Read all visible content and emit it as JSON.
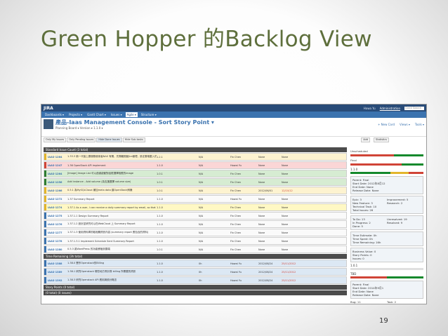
{
  "slide": {
    "title": "Green Hopper 的Backlog View",
    "page_number": "19"
  },
  "jira": {
    "logo": "JIRA",
    "user": "Howa Yu",
    "admin_link": "Administration",
    "search_placeholder": "Quick Search",
    "nav": [
      "Dashboards ▾",
      "Projects ▾",
      "Gantt Chart ▾",
      "Issues ▾",
      "Agile ▾",
      "Structure ▾"
    ],
    "nav_active_index": 4,
    "header": {
      "title": "產品-Iaas Management Console - Sort Story Point ▾",
      "subtitle": "Planning Board ▾   Version ▾   1.1.0 ▾",
      "actions": [
        "+ New Card",
        "Views ▾",
        "Tools ▾"
      ]
    },
    "filters": [
      "Only My Issues",
      "Only Pending Issues",
      "Hide Done Issues",
      "Hide Sub-tasks"
    ],
    "filters_selected_index": 2,
    "filter_right": [
      "Add",
      "Statistics"
    ],
    "sections": {
      "standard": "Standard Issue Count (3 total)",
      "time": "Time Remaining (3h total)",
      "story": "Story Points (0 total)",
      "extra": "(0 total) (0 issues)"
    },
    "rows_standard": [
      {
        "key": "IAAS-1264",
        "summary": "1.33.3 新一代接上雲服務使用者NAS 有關，先隔離推動Jira管理，設定雲端載入的轉換",
        "version": "1.2.1",
        "estimate": "N/A",
        "assignee": "Fin Chen",
        "reporter": "None",
        "due": "None",
        "color": "beige",
        "strip": "#e3b52c"
      },
      {
        "key": "IAAS-1247",
        "summary": "1.36 OpenStack API implement",
        "version": "1.1.0",
        "estimate": "N/A",
        "assignee": "Howai Yu",
        "reporter": "None",
        "due": "None",
        "color": "pink",
        "strip": "#d04437"
      },
      {
        "key": "IAAS-1264",
        "summary": "[Image] Image List 可以過濾啟動對話框選擇相應的image",
        "version": "1.0.1",
        "estimate": "N/A",
        "assignee": "Fin Chen",
        "reporter": "None",
        "due": "None",
        "color": "green",
        "strip": "#2e7d32"
      },
      {
        "key": "IAAS-1256",
        "summary": "Add instance - Add volume (為支援選擇 volume size)",
        "version": "1.0.1",
        "estimate": "N/A",
        "assignee": "Fin Chen",
        "reporter": "None",
        "due": "None",
        "color": "green",
        "strip": "#2e7d32"
      },
      {
        "key": "IAAS-1266",
        "summary": "0.5.1 為MySQLCloud 補加meta data 讓OpenStack辨識",
        "version": "1.0.1",
        "estimate": "N/A",
        "assignee": "Fin Chen",
        "reporter": "2012/06/01",
        "due": "12/10/12",
        "color": "beige",
        "strip": "#e3b52c"
      },
      {
        "key": "IAAS-1272",
        "summary": "1.37 Summary Report",
        "version": "1.1.0",
        "estimate": "N/A",
        "assignee": "Howai Yu",
        "reporter": "None",
        "due": "None",
        "color": "white",
        "strip": "#e3b52c"
      },
      {
        "key": "IAAS-1274",
        "summary": "1.37.1 As a user, I can receive a daily summary report by email, so that I can know my system status and health",
        "version": "1.1.0",
        "estimate": "N/A",
        "assignee": "Fin Chen",
        "reporter": "None",
        "due": "None",
        "color": "yellow",
        "strip": "#e3b52c"
      },
      {
        "key": "IAAS-1275",
        "summary": "1.37.1.1 Design Summary Report",
        "version": "1.1.0",
        "estimate": "N/A",
        "assignee": "Fin Chen",
        "reporter": "None",
        "due": "None",
        "color": "white",
        "strip": "#3b73af"
      },
      {
        "key": "IAAS-1276",
        "summary": "1.37.1.2 設計並研究可以在WebCloud 上 Summary Report",
        "version": "1.1.0",
        "estimate": "N/A",
        "assignee": "Fin Chen",
        "reporter": "None",
        "due": "None",
        "color": "white",
        "strip": "#3b73af"
      },
      {
        "key": "IAAS-1277",
        "summary": "1.37.1.3 使用資料庫抓取相關資訊內容 (summary report 應包含的資料)",
        "version": "1.1.0",
        "estimate": "N/A",
        "assignee": "Fin Chen",
        "reporter": "None",
        "due": "None",
        "color": "white",
        "strip": "#3b73af"
      },
      {
        "key": "IAAS-1278",
        "summary": "1.37.1.3.1 Implement Schedule Sent Summary Report",
        "version": "1.1.0",
        "estimate": "N/A",
        "assignee": "Fin Chen",
        "reporter": "None",
        "due": "None",
        "color": "white",
        "strip": "#3b73af"
      },
      {
        "key": "IAAS-1280",
        "summary": "0.5.3 將WordPress 的功能移植到雲端",
        "version": "1.0.1",
        "estimate": "N/A",
        "assignee": "Fin Chen",
        "reporter": "None",
        "due": "None",
        "color": "white",
        "strip": "#3b73af"
      }
    ],
    "rows_time": [
      {
        "key": "IAAS-1388",
        "summary": "1.38.0 實作Openstack的Billing",
        "version": "1.1.0",
        "estimate": "0h",
        "assignee": "Howai Yu",
        "reporter": "2012/08/24",
        "due": "25/11/2012",
        "color": "blue",
        "strip": "#3b73af"
      },
      {
        "key": "IAAS-1389",
        "summary": "1.38.1 研究Openstack 哪些地方會計算 billing 所需要的資訊",
        "version": "1.1.0",
        "estimate": "0h",
        "assignee": "Howai Yu",
        "reporter": "2012/08/24",
        "due": "25/11/2012",
        "color": "blue",
        "strip": "#3b73af"
      },
      {
        "key": "IAAS-1392",
        "summary": "1.38.3 研究Openstack API 應用與設計概念",
        "version": "1.1.0",
        "estimate": "0h",
        "assignee": "Howai Yu",
        "reporter": "2012/08/24",
        "due": "25/11/2012",
        "color": "blue",
        "strip": "#3b73af"
      }
    ],
    "right_panel": {
      "unscheduled": "Unscheduled",
      "final": "Final",
      "version": "1.1.0",
      "stats": [
        "Parent: Final",
        "Start Date: 2012年8月12",
        "End Date: None",
        "Release Date: None"
      ],
      "counts_left": [
        "Epic: 3",
        "New Feature: 3",
        "Technical Task: 10",
        "Total Issues: 26"
      ],
      "counts_right": [
        "Improvement: 5",
        "Research: 2",
        "",
        ""
      ],
      "status_left": [
        "To Do: 13",
        "In Progress: 2",
        "Done: 5"
      ],
      "status_right": [
        "Unresolved: 19",
        "Resolved: 9",
        ""
      ],
      "time": [
        "Time Estimate: 0h",
        "Time Spent: 0h",
        "Time Remaining: 16h"
      ],
      "value": [
        "Business Value: 0",
        "Story Points: 0",
        "Issues: 0"
      ],
      "v2": "1.0.1",
      "tbd": "TBD",
      "tbd_stats": [
        "Parent: Final",
        "Start Date: 2014年9月1",
        "End Date: None",
        "Release Date: None"
      ],
      "bug": "Bug: 11",
      "task": "Task: 2"
    }
  }
}
